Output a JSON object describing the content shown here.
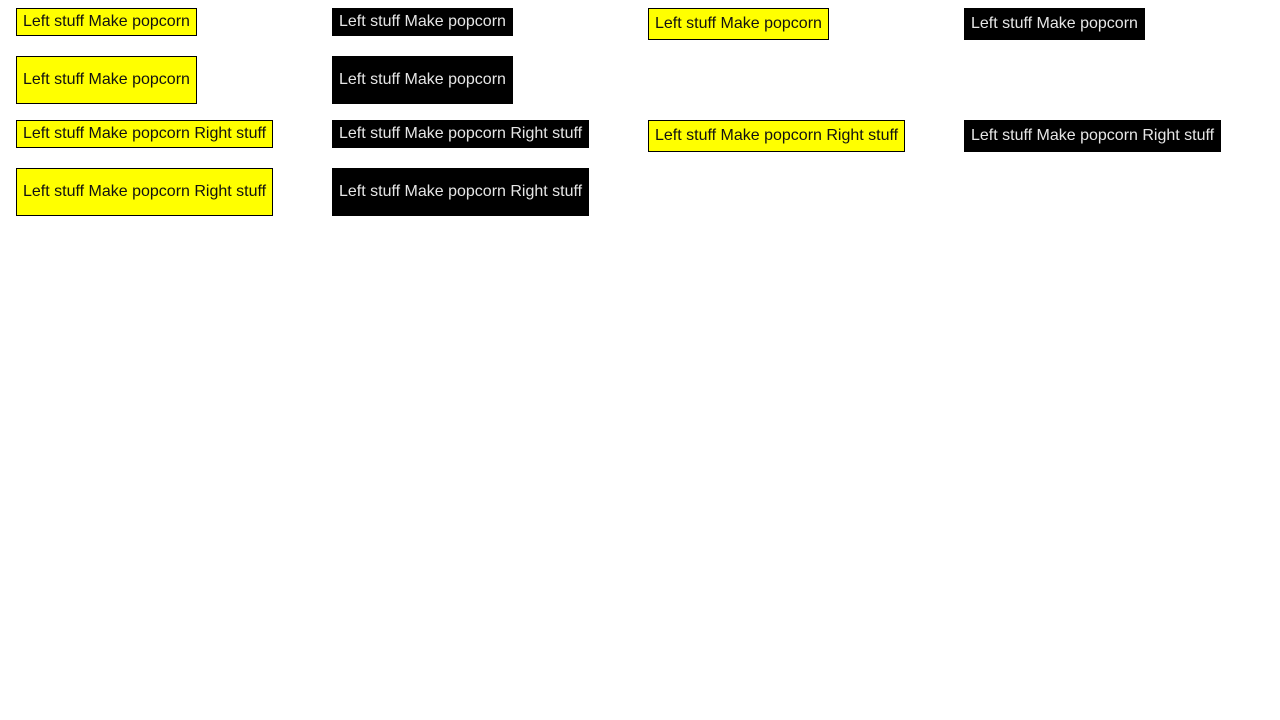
{
  "labels": {
    "left": "Left stuff",
    "center": "Make popcorn",
    "right": "Right stuff"
  },
  "colors": {
    "yellow_bg": "#ffff00",
    "yellow_text": "#111111",
    "black_bg": "#000000",
    "black_text": "#e6e6e6",
    "border": "#000000"
  }
}
